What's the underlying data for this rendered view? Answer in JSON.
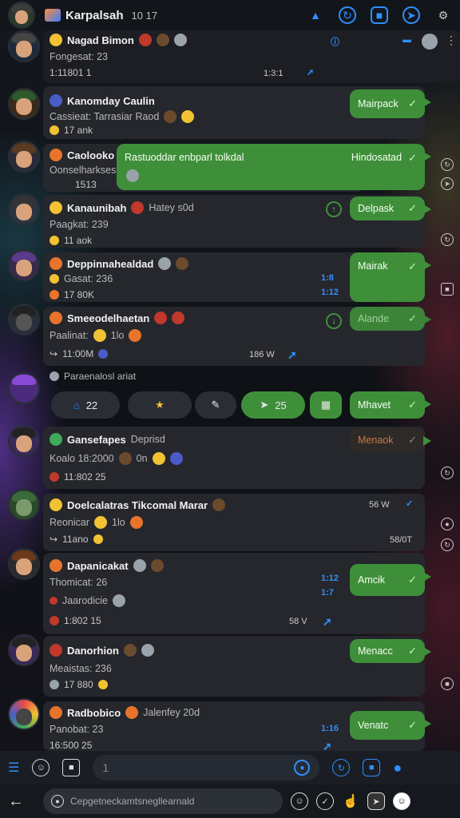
{
  "header": {
    "title": "Karpalsah",
    "subtitle": "10 17"
  },
  "messages": [
    {
      "name": "Nagad Bimon",
      "preview": "Fongesat: 23",
      "time": "1:11801 1",
      "right_meta": "1:3:1",
      "bubble": null
    },
    {
      "name": "Kanomday Caulin",
      "preview": "Cassieat: Tarrasiar Raod",
      "time": "17 ank",
      "bubble": "Mairpack"
    },
    {
      "name": "Caolooko",
      "preview": "Oonselharkses",
      "time": "1513",
      "wide_bubble": "Rastuoddar enbparl tolkdal",
      "bubble": "Hindosatad"
    },
    {
      "name": "Kanaunibah",
      "status": "Hatey s0d",
      "preview": "Paagkat: 239",
      "time": "11 aok",
      "bubble": "Delpask"
    },
    {
      "name": "Deppinnahealdad",
      "preview": "Gasat: 236",
      "time": "17 80K",
      "side_top": "1:8",
      "side_bottom": "1:12",
      "bubble": "Mairak"
    },
    {
      "name": "Smeeodelhaetan",
      "preview": "Paalinat:",
      "preview_tail": "1lo",
      "time": "11:00M",
      "right_meta": "186 W",
      "bubble": "Alande"
    },
    {
      "name": "Gansefapes",
      "status": "Deprisd",
      "preview": "Koalo 18:2000",
      "preview_tail": "0n",
      "time": "11:802 25",
      "bubble": "Menaok"
    },
    {
      "name": "Doelcalatras Tikcomal Marar",
      "preview": "Reonicar",
      "preview_tail": "1lo",
      "time": "11ano",
      "right_meta": "56 W",
      "right_meta2": "58/0T",
      "bubble": null
    },
    {
      "name": "Dapanicakat",
      "preview": "Thomicat: 26",
      "preview2": "Jaarodicie",
      "time": "1:802 15",
      "side_top": "1:12",
      "side_bottom": "1:7",
      "right_meta": "58 V",
      "bubble": "Amcik"
    },
    {
      "name": "Danorhion",
      "preview": "Meaistas: 236",
      "time": "17 880",
      "bubble": "Menacc"
    },
    {
      "name": "Radbobico",
      "status": "Jalenfey 20d",
      "preview": "Panobat: 23",
      "time": "16:500 25",
      "side_top": "1:16",
      "bubble": "Venatc"
    }
  ],
  "reaction_bar": {
    "group_label": "Paraenalosl ariat",
    "count_a": "22",
    "count_green": "25",
    "bubble": "Mhavet"
  },
  "composer": {
    "placeholder": "1"
  },
  "navbar": {
    "search_text": "Cepgetneckamtsnegllearnald"
  }
}
